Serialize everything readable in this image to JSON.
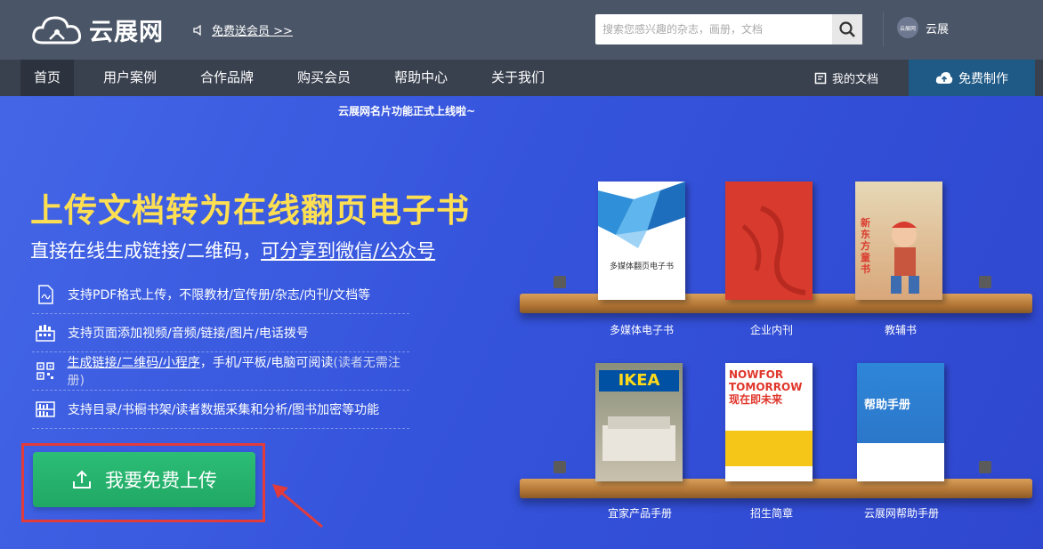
{
  "header": {
    "logo_text": "云展网",
    "promo_link": "免费送会员 >>",
    "search_placeholder": "搜索您感兴趣的杂志，画册，文档",
    "user_name": "云展",
    "avatar_text": "云展网"
  },
  "nav": {
    "items": [
      {
        "label": "首页"
      },
      {
        "label": "用户案例"
      },
      {
        "label": "合作品牌"
      },
      {
        "label": "购买会员"
      },
      {
        "label": "帮助中心"
      },
      {
        "label": "关于我们"
      }
    ],
    "my_docs": "我的文档",
    "create": "免费制作"
  },
  "hero": {
    "notice": "云展网名片功能正式上线啦~",
    "headline": "上传文档转为在线翻页电子书",
    "subline_prefix": "直接在线生成链接/二维码，",
    "subline_link": "可分享到微信/公众号",
    "features": [
      {
        "icon": "pdf-icon",
        "text": "支持PDF格式上传，不限教材/宣传册/杂志/内刊/文档等"
      },
      {
        "icon": "media-icon",
        "text": "支持页面添加视频/音频/链接/图片/电话拨号"
      },
      {
        "icon": "qrcode-icon",
        "link": "生成链接/二维码/小程序",
        "text": "，手机/平板/电脑可阅读",
        "grey": "(读者无需注册)"
      },
      {
        "icon": "bookshelf-icon",
        "text": "支持目录/书橱书架/读者数据采集和分析/图书加密等功能"
      }
    ],
    "upload_button": "我要免费上传"
  },
  "books": [
    {
      "label": "多媒体电子书",
      "cover_title": "多媒体翻页电子书"
    },
    {
      "label": "企业内刊",
      "cover_title": ""
    },
    {
      "label": "教辅书",
      "cover_title": "新东方童书"
    },
    {
      "label": "宜家产品手册",
      "cover_title": "IKEA"
    },
    {
      "label": "招生简章",
      "cover_title": "NOWFOR TOMORROW 现在即未来"
    },
    {
      "label": "云展网帮助手册",
      "cover_title": "帮助手册"
    }
  ],
  "colors": {
    "topbar": "#4a5567",
    "nav": "#39414f",
    "hero": "#3b57d8",
    "headline": "#ffdf52",
    "upload": "#22aa66",
    "highlight_frame": "#e23b3b"
  }
}
